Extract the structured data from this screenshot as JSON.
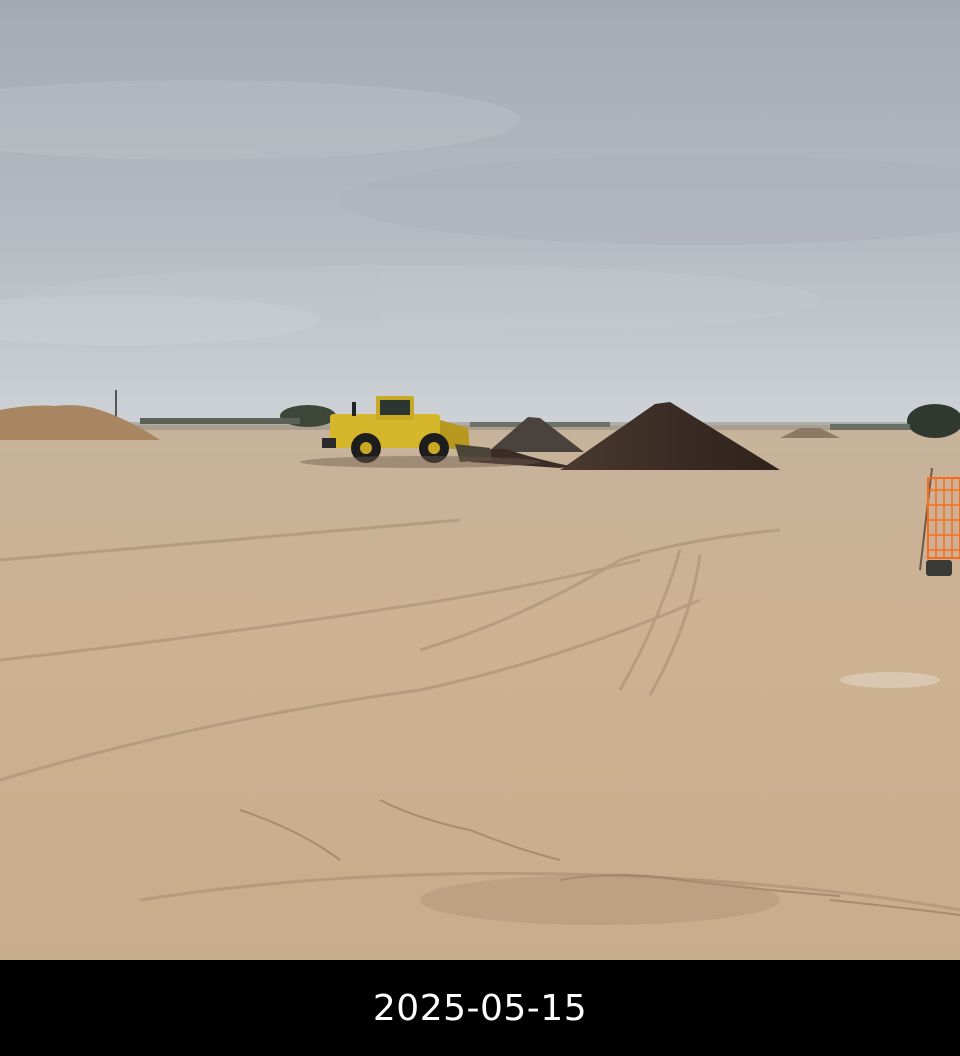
{
  "caption": {
    "date": "2025-05-15"
  },
  "scene": {
    "subjects": [
      "wheel-loader",
      "soil-pile",
      "dirt-field",
      "overcast-sky",
      "tree-line",
      "orange-safety-fence"
    ],
    "colors": {
      "sky_top": "#9ca3ab",
      "sky_bottom": "#c9ced4",
      "ground_light": "#cdb396",
      "ground_dark": "#b39a7c",
      "soil_pile": "#3b2d25",
      "loader_yellow": "#d6b62a",
      "fence_orange": "#ff6a1a"
    }
  }
}
